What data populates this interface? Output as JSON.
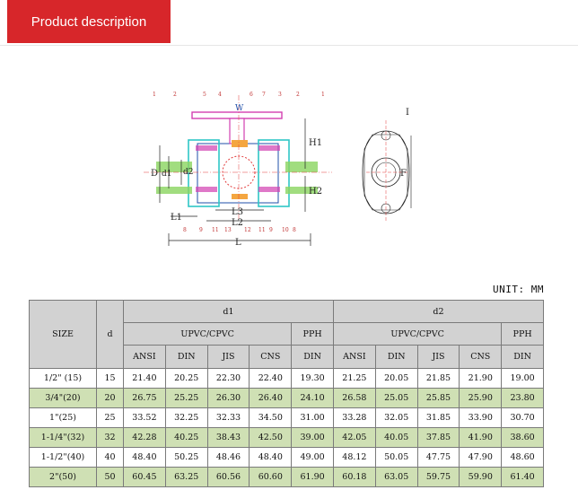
{
  "header": {
    "tab_label": "Product description"
  },
  "drawing": {
    "top_numbers": [
      "1",
      "2",
      "5",
      "4",
      "6",
      "7",
      "3",
      "2",
      "1"
    ],
    "bottom_numbers": [
      "8",
      "9",
      "11",
      "13",
      "12",
      "11",
      "9",
      "10",
      "8"
    ],
    "labels": {
      "w": "W",
      "h1": "H1",
      "h2": "H2",
      "d": "D",
      "d1": "d1",
      "d2": "d2",
      "l1": "L1",
      "l2": "L2",
      "l3": "L3",
      "l": "L",
      "i": "I",
      "f": "F"
    }
  },
  "unit_label": "UNIT: MM",
  "table": {
    "size_header": "SIZE",
    "d_header": "d",
    "d1_header": "d1",
    "d2_header": "d2",
    "upvc_header": "UPVC/CPVC",
    "pph_header": "PPH",
    "sub_headers": [
      "ANSI",
      "DIN",
      "JIS",
      "CNS",
      "DIN",
      "ANSI",
      "DIN",
      "JIS",
      "CNS",
      "DIN"
    ],
    "rows": [
      {
        "size": "1/2\" (15)",
        "d": "15",
        "vals": [
          "21.40",
          "20.25",
          "22.30",
          "22.40",
          "19.30",
          "21.25",
          "20.05",
          "21.85",
          "21.90",
          "19.00"
        ]
      },
      {
        "size": "3/4\"(20)",
        "d": "20",
        "vals": [
          "26.75",
          "25.25",
          "26.30",
          "26.40",
          "24.10",
          "26.58",
          "25.05",
          "25.85",
          "25.90",
          "23.80"
        ]
      },
      {
        "size": "1\"(25)",
        "d": "25",
        "vals": [
          "33.52",
          "32.25",
          "32.33",
          "34.50",
          "31.00",
          "33.28",
          "32.05",
          "31.85",
          "33.90",
          "30.70"
        ]
      },
      {
        "size": "1-1/4\"(32)",
        "d": "32",
        "vals": [
          "42.28",
          "40.25",
          "38.43",
          "42.50",
          "39.00",
          "42.05",
          "40.05",
          "37.85",
          "41.90",
          "38.60"
        ]
      },
      {
        "size": "1-1/2\"(40)",
        "d": "40",
        "vals": [
          "48.40",
          "50.25",
          "48.46",
          "48.40",
          "49.00",
          "48.12",
          "50.05",
          "47.75",
          "47.90",
          "48.60"
        ]
      },
      {
        "size": "2\"(50)",
        "d": "50",
        "vals": [
          "60.45",
          "63.25",
          "60.56",
          "60.60",
          "61.90",
          "60.18",
          "63.05",
          "59.75",
          "59.90",
          "61.40"
        ]
      }
    ]
  }
}
